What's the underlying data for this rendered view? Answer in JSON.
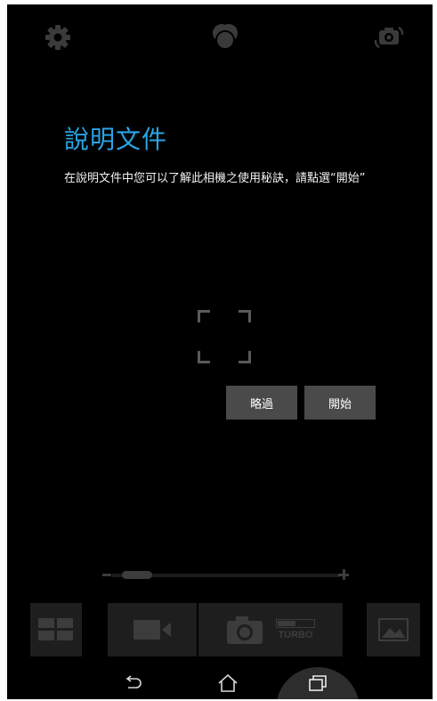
{
  "top_bar": {
    "settings_icon": "gear-icon",
    "filter_icon": "color-filter-icon",
    "switch_camera_icon": "switch-camera-icon"
  },
  "tutorial": {
    "title": "說明文件",
    "description": "在說明文件中您可以了解此相機之使用秘訣，請點選“開始”"
  },
  "dialog": {
    "skip_label": "略過",
    "start_label": "開始"
  },
  "zoom": {
    "minus_icon": "minus-icon",
    "plus_icon": "plus-icon",
    "level": 0.05
  },
  "controls": {
    "mode_icon": "grid-mode-icon",
    "video_icon": "video-camera-icon",
    "shutter_icon": "camera-icon",
    "turbo_label": "TURBO",
    "gallery_icon": "gallery-icon"
  },
  "nav": {
    "back_icon": "back-icon",
    "home_icon": "home-icon",
    "recent_icon": "recent-apps-icon"
  },
  "colors": {
    "accent": "#2aa5e4",
    "background": "#000000",
    "button": "#4a4a4a"
  }
}
